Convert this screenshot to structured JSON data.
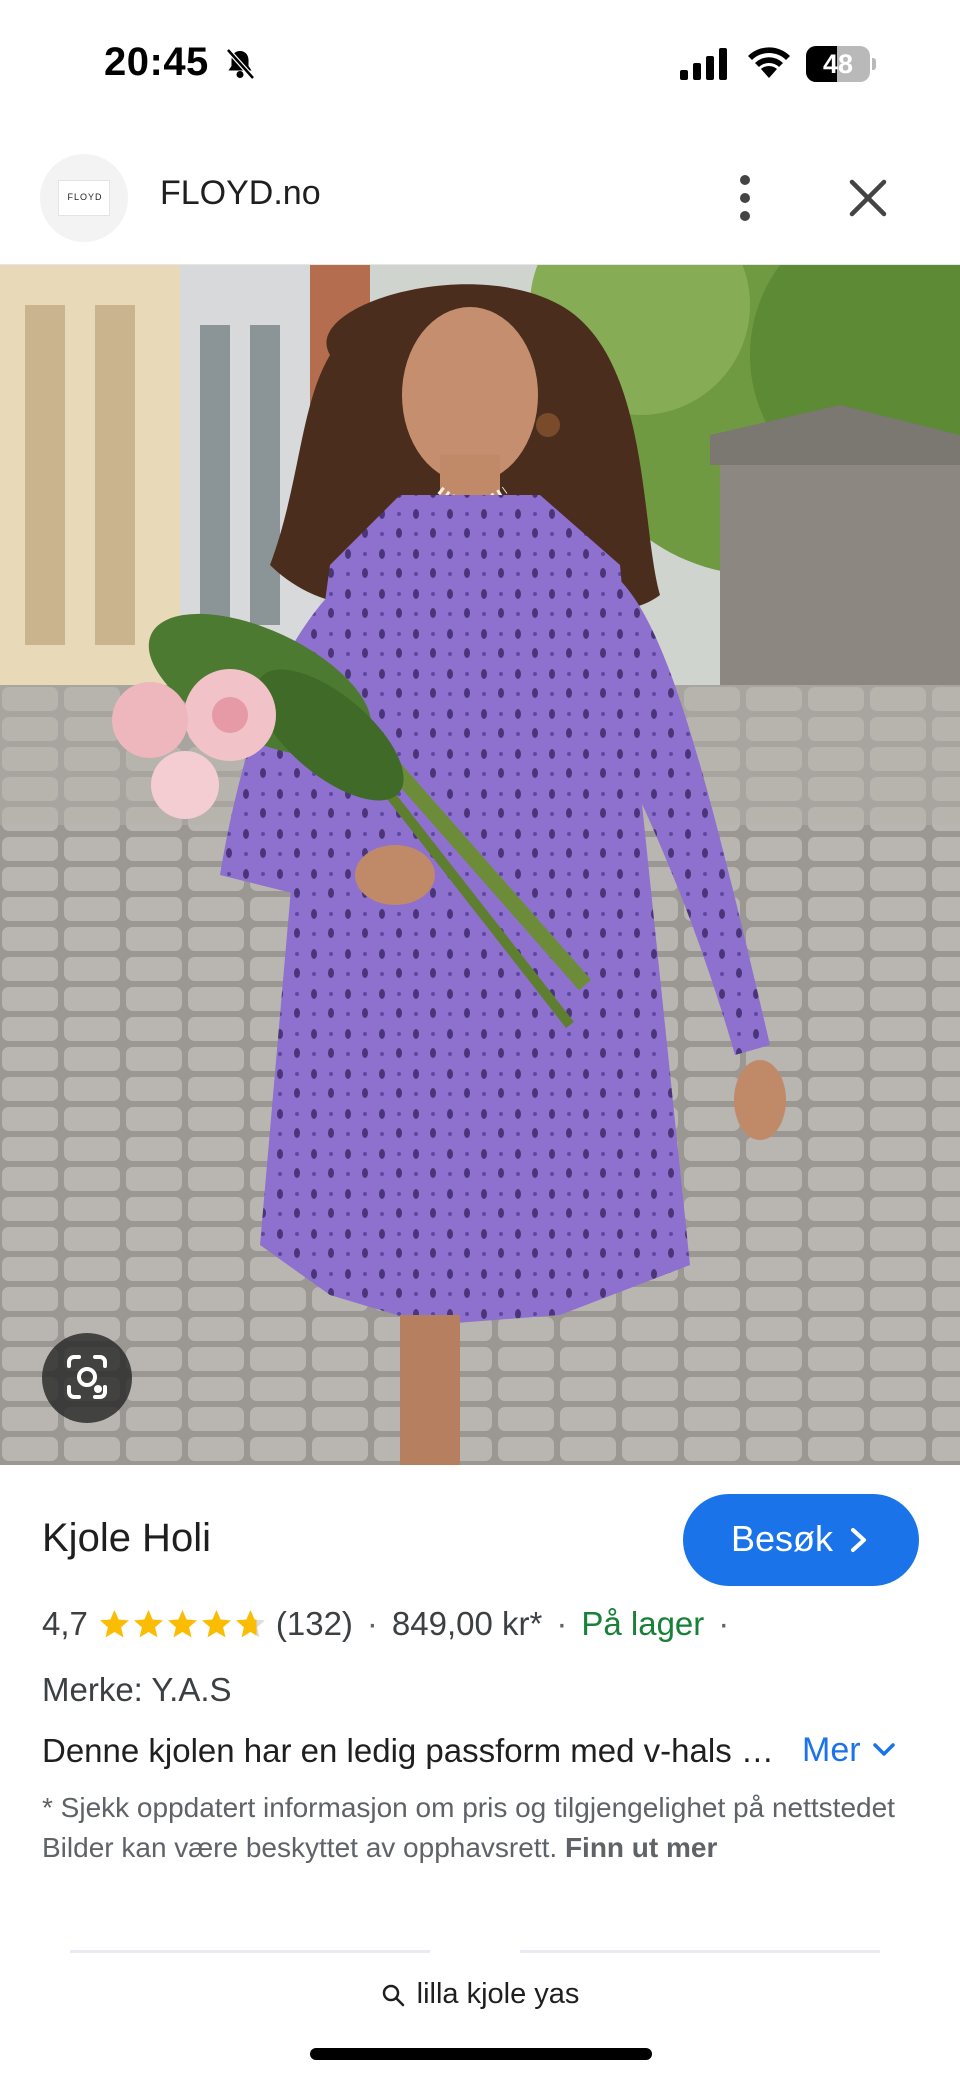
{
  "status_bar": {
    "time": "20:45",
    "battery_level": "48",
    "battery_fraction": 0.48,
    "icons": [
      "bell-muted-icon",
      "signal-icon",
      "wifi-icon",
      "battery-icon"
    ]
  },
  "header": {
    "logo_text": "FLOYD",
    "site_name": "FLOYD.no",
    "menu_icon": "more-vertical-icon",
    "close_icon": "close-icon"
  },
  "image": {
    "description_icon": "lens-icon",
    "dress_color": "#8e70cf"
  },
  "product": {
    "title": "Kjole Holi",
    "visit_label": "Besøk",
    "rating": "4,7",
    "rating_value": 4.7,
    "rating_max": 5,
    "review_count": "(132)",
    "separator": "·",
    "price": "849,00 kr*",
    "availability": "På lager",
    "brand": "Merke: Y.A.S",
    "description": "Denne kjolen har en ledig passform med v-hals og lange ballongermer",
    "more_label": "Mer",
    "disclaimer": "* Sjekk oppdatert informasjon om pris og tilgjengelighet på nettstedet Bilder kan være beskyttet av opphavsrett.",
    "disclaimer_link": "Finn ut mer"
  },
  "colors": {
    "accent": "#1a73e8",
    "in_stock": "#188038",
    "star": "#fbbc04"
  },
  "bottom": {
    "search_query": "lilla kjole yas"
  }
}
